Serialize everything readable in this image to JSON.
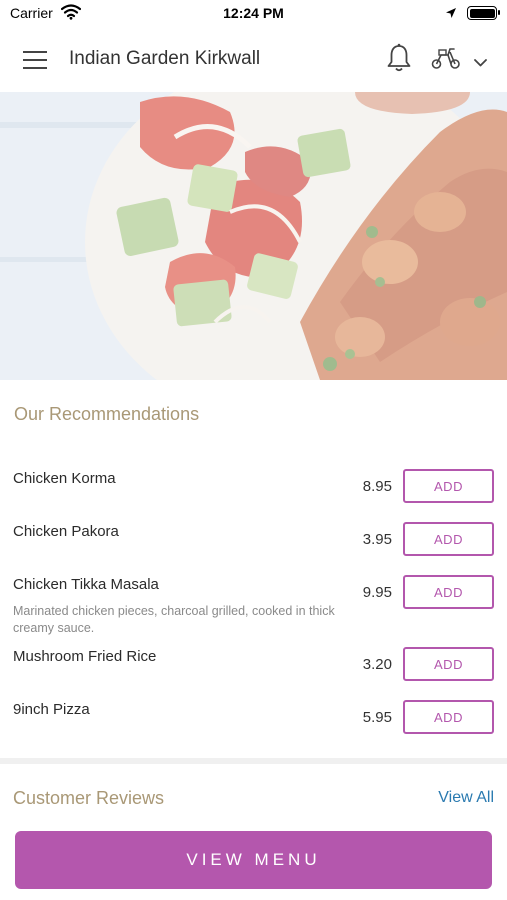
{
  "status_bar": {
    "carrier": "Carrier",
    "time": "12:24 PM"
  },
  "header": {
    "title": "Indian Garden Kirkwall",
    "icons": [
      "menu-icon",
      "bell-icon",
      "scooter-icon",
      "chevron-down-icon"
    ]
  },
  "recommendations": {
    "title": "Our Recommendations",
    "items": [
      {
        "name": "Chicken Korma",
        "description": "",
        "price": "8.95",
        "button": "ADD"
      },
      {
        "name": "Chicken Pakora",
        "description": "",
        "price": "3.95",
        "button": "ADD"
      },
      {
        "name": "Chicken Tikka Masala",
        "description": "Marinated chicken pieces, charcoal grilled, cooked in thick creamy sauce.",
        "price": "9.95",
        "button": "ADD"
      },
      {
        "name": "Mushroom Fried Rice",
        "description": "",
        "price": "3.20",
        "button": "ADD"
      },
      {
        "name": "9inch Pizza",
        "description": "",
        "price": "5.95",
        "button": "ADD"
      }
    ]
  },
  "reviews": {
    "title": "Customer Reviews",
    "view_all": "View All"
  },
  "footer": {
    "view_menu": "VIEW MENU"
  },
  "colors": {
    "accent": "#b457ad",
    "section_title": "#a99876",
    "link": "#2a7ab0"
  }
}
